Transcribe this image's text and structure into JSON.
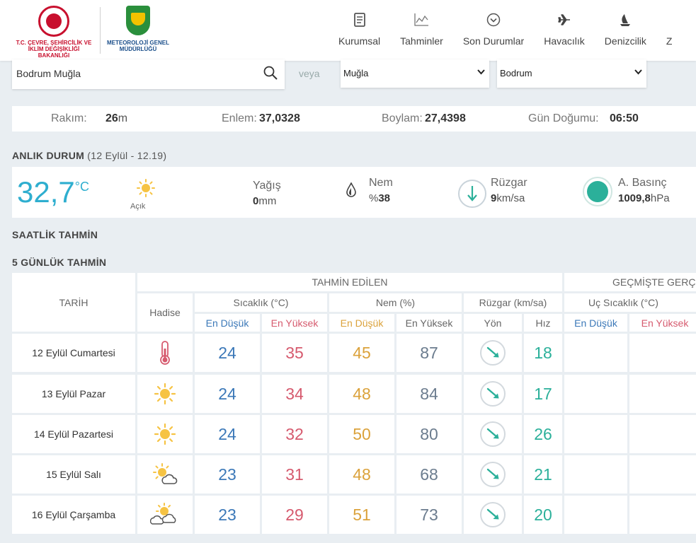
{
  "header": {
    "logo1_text": "T.C. ÇEVRE, ŞEHİRCİLİK VE İKLİM DEĞİŞİKLİĞİ BAKANLIĞI",
    "logo2_text": "METEOROLOJİ GENEL MÜDÜRLÜĞÜ",
    "nav": [
      {
        "label": "Kurumsal",
        "icon": "document-icon"
      },
      {
        "label": "Tahminler",
        "icon": "chart-icon"
      },
      {
        "label": "Son Durumlar",
        "icon": "chevron-circle-icon"
      },
      {
        "label": "Havacılık",
        "icon": "plane-icon"
      },
      {
        "label": "Denizcilik",
        "icon": "sailboat-icon"
      },
      {
        "label": "Z"
      }
    ]
  },
  "search": {
    "value": "Bodrum Muğla",
    "or_label": "veya",
    "province": "Muğla",
    "district": "Bodrum"
  },
  "info": {
    "altitude_label": "Rakım:",
    "altitude_value": "26",
    "altitude_unit": "m",
    "lat_label": "Enlem:",
    "lat_value": "37,0328",
    "lon_label": "Boylam:",
    "lon_value": "27,4398",
    "sunrise_label": "Gün Doğumu:",
    "sunrise_value": "06:50"
  },
  "current": {
    "title": "ANLIK DURUM",
    "subtitle": "(12 Eylül - 12.19)",
    "temp": "32,7",
    "temp_unit": "°C",
    "condition": "Açık",
    "precip_label": "Yağış",
    "precip_value": "0",
    "precip_unit": "mm",
    "humidity_label": "Nem",
    "humidity_prefix": "%",
    "humidity_value": "38",
    "wind_label": "Rüzgar",
    "wind_value": "9",
    "wind_unit": "km/sa",
    "pressure_label": "A. Basınç",
    "pressure_value": "1009,8",
    "pressure_unit": "hPa"
  },
  "sections": {
    "hourly": "SAATLİK TAHMİN",
    "daily": "5 GÜNLÜK TAHMİN"
  },
  "table": {
    "h_forecast": "TAHMİN EDİLEN",
    "h_past": "GEÇMİŞTE GERÇEK",
    "h_date": "TARİH",
    "h_event": "Hadise",
    "h_temp": "Sıcaklık (°C)",
    "h_hum": "Nem (%)",
    "h_wind": "Rüzgar (km/sa)",
    "h_extreme": "Uç Sıcaklık (°C)",
    "h_low": "En Düşük",
    "h_high": "En Yüksek",
    "h_dir": "Yön",
    "h_speed": "Hız",
    "colors": {
      "low": "#3b78b8",
      "high": "#d65a6e",
      "hum_low": "#dba23b",
      "hum_high": "#6b7c8e",
      "wind": "#2bb09a"
    },
    "rows": [
      {
        "date": "12 Eylül Cumartesi",
        "icon": "thermometer-icon",
        "t_low": "24",
        "t_high": "35",
        "h_low": "45",
        "h_high": "87",
        "speed": "18"
      },
      {
        "date": "13 Eylül Pazar",
        "icon": "sun-icon",
        "t_low": "24",
        "t_high": "34",
        "h_low": "48",
        "h_high": "84",
        "speed": "17"
      },
      {
        "date": "14 Eylül Pazartesi",
        "icon": "sun-icon",
        "t_low": "24",
        "t_high": "32",
        "h_low": "50",
        "h_high": "80",
        "speed": "26"
      },
      {
        "date": "15 Eylül Salı",
        "icon": "sun-cloud-icon",
        "t_low": "23",
        "t_high": "31",
        "h_low": "48",
        "h_high": "68",
        "speed": "21"
      },
      {
        "date": "16 Eylül Çarşamba",
        "icon": "sun-clouds-icon",
        "t_low": "23",
        "t_high": "29",
        "h_low": "51",
        "h_high": "73",
        "speed": "20"
      }
    ]
  }
}
